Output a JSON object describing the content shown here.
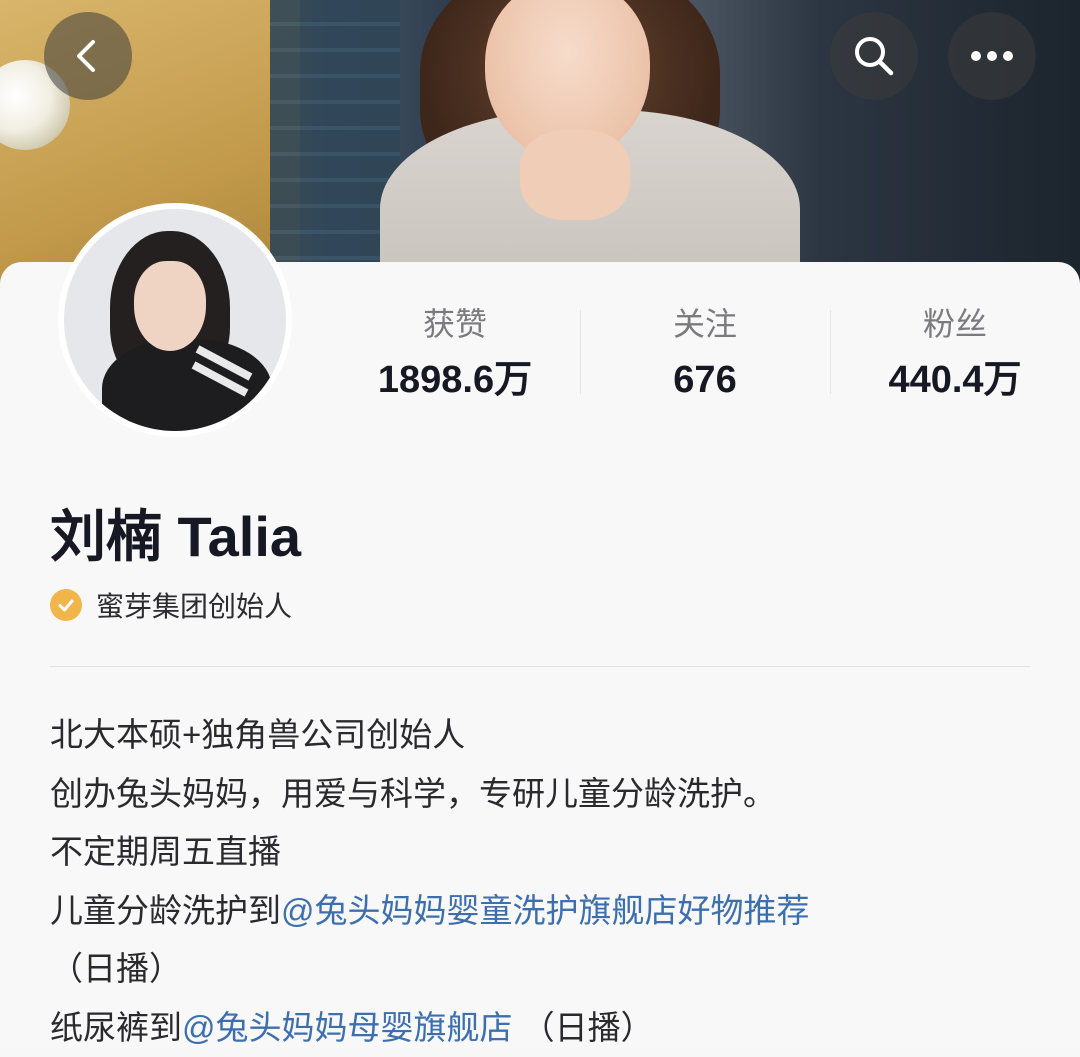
{
  "header": {
    "back_icon": "back-arrow-icon",
    "search_icon": "search-icon",
    "more_icon": "more-dots-icon"
  },
  "profile": {
    "name": "刘楠 Talia",
    "verification": "蜜芽集团创始人",
    "verified_color": "#f2b54a"
  },
  "stats": [
    {
      "label": "获赞",
      "value": "1898.6万"
    },
    {
      "label": "关注",
      "value": "676"
    },
    {
      "label": "粉丝",
      "value": "440.4万"
    }
  ],
  "bio": {
    "line1": "北大本硕+独角兽公司创始人",
    "line2": "创办兔头妈妈，用爱与科学，专研儿童分龄洗护。",
    "line3": "不定期周五直播",
    "line4_prefix": "儿童分龄洗护到",
    "line4_mention": "@兔头妈妈婴童洗护旗舰店好物推荐",
    "line5": "（日播）",
    "line6_prefix": "纸尿裤到",
    "line6_mention": "@兔头妈妈母婴旗舰店",
    "line6_suffix": " （日播）"
  },
  "colors": {
    "mention": "#3d6fae",
    "background": "#f8f8f8"
  }
}
